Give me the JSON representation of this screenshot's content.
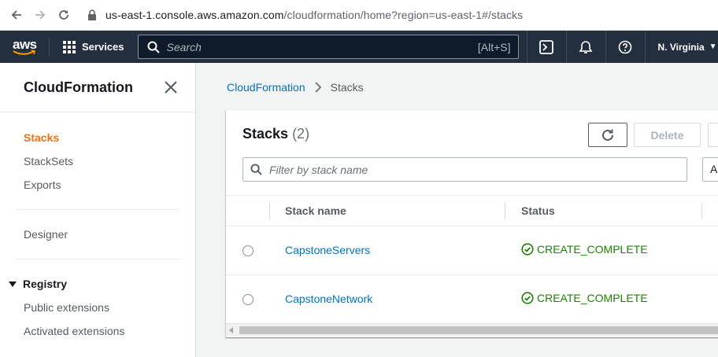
{
  "browser": {
    "url_host": "us-east-1.console.aws.amazon.com",
    "url_path": "/cloudformation/home?region=us-east-1#/stacks"
  },
  "topnav": {
    "logo_text": "aws",
    "services_label": "Services",
    "search_placeholder": "Search",
    "search_shortcut": "[Alt+S]",
    "region_label": "N. Virginia"
  },
  "sidebar": {
    "title": "CloudFormation",
    "items": [
      {
        "label": "Stacks",
        "active": true
      },
      {
        "label": "StackSets"
      },
      {
        "label": "Exports"
      }
    ],
    "designer_label": "Designer",
    "registry_label": "Registry",
    "registry_items": [
      {
        "label": "Public extensions"
      },
      {
        "label": "Activated extensions"
      }
    ]
  },
  "breadcrumb": {
    "root": "CloudFormation",
    "current": "Stacks"
  },
  "panel": {
    "title": "Stacks",
    "count": "(2)",
    "delete_label": "Delete",
    "filter_placeholder": "Filter by stack name",
    "action_select_value": "Ac",
    "columns": {
      "name": "Stack name",
      "status": "Status"
    },
    "rows": [
      {
        "name": "CapstoneServers",
        "status": "CREATE_COMPLETE"
      },
      {
        "name": "CapstoneNetwork",
        "status": "CREATE_COMPLETE"
      }
    ]
  },
  "colors": {
    "aws_nav_bg": "#232f3e",
    "accent_orange": "#ec7211",
    "link_blue": "#0073bb",
    "success_green": "#1d8102"
  }
}
